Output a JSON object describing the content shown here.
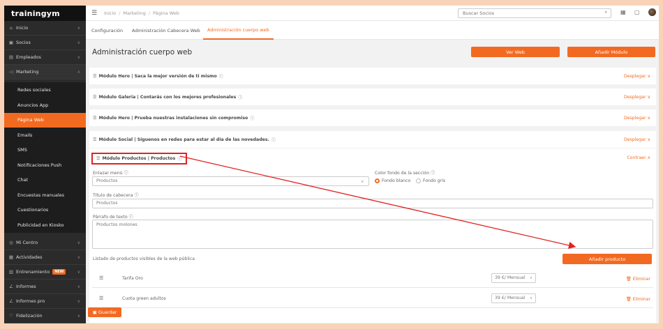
{
  "app": {
    "logo": "trainingym"
  },
  "sidebar": {
    "items": [
      {
        "label": "Inicio",
        "icon": "⌂",
        "name": "home-icon"
      },
      {
        "label": "Socios",
        "icon": "▣",
        "name": "members-icon"
      },
      {
        "label": "Empleados",
        "icon": "▤",
        "name": "employees-icon"
      },
      {
        "label": "Marketing",
        "icon": "◁",
        "name": "marketing-icon"
      }
    ],
    "marketing_sub": [
      "Redes sociales",
      "Anuncios App",
      "Página Web",
      "Emails",
      "SMS",
      "Notificaciones Push",
      "Chat",
      "Encuestas manuales",
      "Cuestionarios",
      "Publicidad en Kiosko"
    ],
    "items_bottom": [
      {
        "label": "Mi Centro",
        "icon": "◎",
        "name": "center-icon"
      },
      {
        "label": "Actividades",
        "icon": "▦",
        "name": "activities-icon"
      },
      {
        "label": "Entrenamiento",
        "icon": "▥",
        "name": "training-icon",
        "badge": "NEW"
      },
      {
        "label": "Informes",
        "icon": "∠",
        "name": "reports-icon"
      },
      {
        "label": "Informes pro",
        "icon": "∠",
        "name": "reports-pro-icon"
      },
      {
        "label": "Fidelización",
        "icon": "♡",
        "name": "loyalty-icon"
      }
    ]
  },
  "topbar": {
    "breadcrumb": [
      "Inicio",
      "Marketing",
      "Página Web"
    ],
    "search_placeholder": "Buscar Socios"
  },
  "tabs": [
    "Configuración",
    "Administración Cabecera Web",
    "Administración cuerpo web"
  ],
  "page": {
    "title": "Administración cuerpo web",
    "view_web": "Ver Web",
    "add_module": "Añadir Módulo",
    "save": "Guardar"
  },
  "modules": [
    {
      "title": "Módulo Hero | Saca la mejor versión de ti mismo",
      "toggle": "Desplegar ∨"
    },
    {
      "title": "Módulo Galeria | Contarás con los mejores profesionales",
      "toggle": "Desplegar ∨"
    },
    {
      "title": "Módulo Hero | Prueba nuestras instalaciones sin compromiso",
      "toggle": "Desplegar ∨"
    },
    {
      "title": "Módulo Social | Síguenos en redes para estar al día de las novedades.",
      "toggle": "Desplegar ∨"
    }
  ],
  "expanded": {
    "title": "Módulo Productos | Productos",
    "toggle": "Contraer ∧",
    "link_menu_label": "Enlazar menú",
    "link_menu_value": "Productos",
    "bg_color_label": "Color fondo de la sección",
    "radio_white": "Fondo blanco",
    "radio_gray": "Fondo gris",
    "header_title_label": "Título de cabecera",
    "header_title_value": "Productos",
    "paragraph_label": "Párrafo de texto",
    "paragraph_value": "Productos molones",
    "list_label": "Listado de productos visibles de la web pública",
    "add_product": "Añadir producto",
    "products": [
      {
        "name": "Tarifa Oro",
        "price": "39 €/ Mensual",
        "delete": "Eliminar"
      },
      {
        "name": "Cuota green adultos",
        "price": "39 €/ Mensual",
        "delete": "Eliminar"
      }
    ]
  },
  "colors": {
    "accent": "#f26a21",
    "sidebar": "#2b2b2b",
    "annotation": "#e02222"
  }
}
